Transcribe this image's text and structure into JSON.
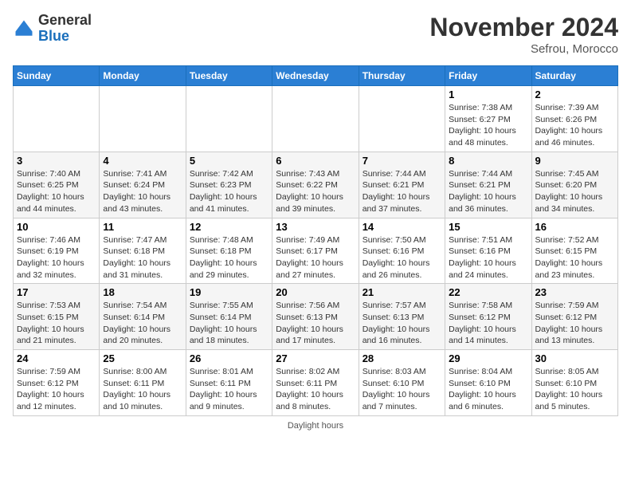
{
  "app": {
    "name": "GeneralBlue",
    "logo_text_1": "General",
    "logo_text_2": "Blue"
  },
  "header": {
    "month": "November 2024",
    "location": "Sefrou, Morocco"
  },
  "days_of_week": [
    "Sunday",
    "Monday",
    "Tuesday",
    "Wednesday",
    "Thursday",
    "Friday",
    "Saturday"
  ],
  "footer": {
    "label": "Daylight hours"
  },
  "weeks": [
    {
      "days": [
        {
          "num": "",
          "info": ""
        },
        {
          "num": "",
          "info": ""
        },
        {
          "num": "",
          "info": ""
        },
        {
          "num": "",
          "info": ""
        },
        {
          "num": "",
          "info": ""
        },
        {
          "num": "1",
          "info": "Sunrise: 7:38 AM\nSunset: 6:27 PM\nDaylight: 10 hours and 48 minutes."
        },
        {
          "num": "2",
          "info": "Sunrise: 7:39 AM\nSunset: 6:26 PM\nDaylight: 10 hours and 46 minutes."
        }
      ]
    },
    {
      "days": [
        {
          "num": "3",
          "info": "Sunrise: 7:40 AM\nSunset: 6:25 PM\nDaylight: 10 hours and 44 minutes."
        },
        {
          "num": "4",
          "info": "Sunrise: 7:41 AM\nSunset: 6:24 PM\nDaylight: 10 hours and 43 minutes."
        },
        {
          "num": "5",
          "info": "Sunrise: 7:42 AM\nSunset: 6:23 PM\nDaylight: 10 hours and 41 minutes."
        },
        {
          "num": "6",
          "info": "Sunrise: 7:43 AM\nSunset: 6:22 PM\nDaylight: 10 hours and 39 minutes."
        },
        {
          "num": "7",
          "info": "Sunrise: 7:44 AM\nSunset: 6:21 PM\nDaylight: 10 hours and 37 minutes."
        },
        {
          "num": "8",
          "info": "Sunrise: 7:44 AM\nSunset: 6:21 PM\nDaylight: 10 hours and 36 minutes."
        },
        {
          "num": "9",
          "info": "Sunrise: 7:45 AM\nSunset: 6:20 PM\nDaylight: 10 hours and 34 minutes."
        }
      ]
    },
    {
      "days": [
        {
          "num": "10",
          "info": "Sunrise: 7:46 AM\nSunset: 6:19 PM\nDaylight: 10 hours and 32 minutes."
        },
        {
          "num": "11",
          "info": "Sunrise: 7:47 AM\nSunset: 6:18 PM\nDaylight: 10 hours and 31 minutes."
        },
        {
          "num": "12",
          "info": "Sunrise: 7:48 AM\nSunset: 6:18 PM\nDaylight: 10 hours and 29 minutes."
        },
        {
          "num": "13",
          "info": "Sunrise: 7:49 AM\nSunset: 6:17 PM\nDaylight: 10 hours and 27 minutes."
        },
        {
          "num": "14",
          "info": "Sunrise: 7:50 AM\nSunset: 6:16 PM\nDaylight: 10 hours and 26 minutes."
        },
        {
          "num": "15",
          "info": "Sunrise: 7:51 AM\nSunset: 6:16 PM\nDaylight: 10 hours and 24 minutes."
        },
        {
          "num": "16",
          "info": "Sunrise: 7:52 AM\nSunset: 6:15 PM\nDaylight: 10 hours and 23 minutes."
        }
      ]
    },
    {
      "days": [
        {
          "num": "17",
          "info": "Sunrise: 7:53 AM\nSunset: 6:15 PM\nDaylight: 10 hours and 21 minutes."
        },
        {
          "num": "18",
          "info": "Sunrise: 7:54 AM\nSunset: 6:14 PM\nDaylight: 10 hours and 20 minutes."
        },
        {
          "num": "19",
          "info": "Sunrise: 7:55 AM\nSunset: 6:14 PM\nDaylight: 10 hours and 18 minutes."
        },
        {
          "num": "20",
          "info": "Sunrise: 7:56 AM\nSunset: 6:13 PM\nDaylight: 10 hours and 17 minutes."
        },
        {
          "num": "21",
          "info": "Sunrise: 7:57 AM\nSunset: 6:13 PM\nDaylight: 10 hours and 16 minutes."
        },
        {
          "num": "22",
          "info": "Sunrise: 7:58 AM\nSunset: 6:12 PM\nDaylight: 10 hours and 14 minutes."
        },
        {
          "num": "23",
          "info": "Sunrise: 7:59 AM\nSunset: 6:12 PM\nDaylight: 10 hours and 13 minutes."
        }
      ]
    },
    {
      "days": [
        {
          "num": "24",
          "info": "Sunrise: 7:59 AM\nSunset: 6:12 PM\nDaylight: 10 hours and 12 minutes."
        },
        {
          "num": "25",
          "info": "Sunrise: 8:00 AM\nSunset: 6:11 PM\nDaylight: 10 hours and 10 minutes."
        },
        {
          "num": "26",
          "info": "Sunrise: 8:01 AM\nSunset: 6:11 PM\nDaylight: 10 hours and 9 minutes."
        },
        {
          "num": "27",
          "info": "Sunrise: 8:02 AM\nSunset: 6:11 PM\nDaylight: 10 hours and 8 minutes."
        },
        {
          "num": "28",
          "info": "Sunrise: 8:03 AM\nSunset: 6:10 PM\nDaylight: 10 hours and 7 minutes."
        },
        {
          "num": "29",
          "info": "Sunrise: 8:04 AM\nSunset: 6:10 PM\nDaylight: 10 hours and 6 minutes."
        },
        {
          "num": "30",
          "info": "Sunrise: 8:05 AM\nSunset: 6:10 PM\nDaylight: 10 hours and 5 minutes."
        }
      ]
    }
  ]
}
